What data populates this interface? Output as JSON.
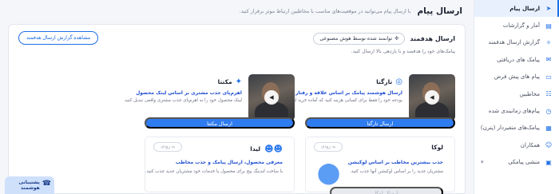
{
  "sidebar": {
    "items": [
      {
        "label": "ارسال پیام",
        "icon": "send-icon",
        "glyph": "➤",
        "active": true,
        "chev": false
      },
      {
        "label": "آمار و گزارشات",
        "icon": "chart-icon",
        "glyph": "▤",
        "active": false,
        "chev": false
      },
      {
        "label": "گزارش ارسال هدفمند",
        "icon": "sparkle-icon",
        "glyph": "✧",
        "active": false,
        "chev": false
      },
      {
        "label": "پیامک های دریافتی",
        "icon": "inbox-icon",
        "glyph": "✉",
        "active": false,
        "chev": false
      },
      {
        "label": "پیام های پیش فرض",
        "icon": "message-icon",
        "glyph": "▭",
        "active": false,
        "chev": false
      },
      {
        "label": "مخاطبین",
        "icon": "contacts-icon",
        "glyph": "☷",
        "active": false,
        "chev": false
      },
      {
        "label": "پیام‌های زمانبندی شده",
        "icon": "clock-icon",
        "glyph": "◷",
        "active": false,
        "chev": false
      },
      {
        "label": "پیامک‌های متغیردار (پترن)",
        "icon": "pattern-icon",
        "glyph": "▦",
        "active": false,
        "chev": false
      },
      {
        "label": "همکاران",
        "icon": "users-icon",
        "glyph": "☺",
        "active": false,
        "chev": false
      },
      {
        "label": "منشی پیامکی",
        "icon": "secretary-icon",
        "glyph": "▣",
        "active": false,
        "chev": true
      }
    ]
  },
  "header": {
    "title": "ارسال پیام",
    "subtitle": "با ارسال پیام می‌توانید در موقعیت‌های مناسب با مخاطبین ارتباط موثر برقرار کنید."
  },
  "panel": {
    "title": "ارسال هدفمند",
    "ai_chip": "توانمند شده توسط هوش مصنوعی",
    "report_button": "مشاهده گزارش ارسال هدفمند",
    "description": "پیامک‌های خود را هدفمند و با بازدهی بالا ارسال کنید."
  },
  "cards": [
    {
      "title": "تارگتا",
      "subtitle": "ارسال هوشمند پیامک بر اساس علاقه و رفتار مخاطبین",
      "text": "بودجه خود را فقط برای کسانی هزینه کنید که آماده خرید از شما هستند.",
      "button": "ارسال تارگتا"
    },
    {
      "title": "مکتتا",
      "subtitle": "اهرم‌پای جذب مشتری بر اساس لینک محصول",
      "text": "لینک محصول خود را به اهرم‌پای جذب مشتری واقعی تبدیل کنید.",
      "button": "ارسال مکتتا"
    }
  ],
  "soon_cards": [
    {
      "title": "لوکا",
      "soon": "به زودی",
      "subtitle": "جذب بیشترین مخاطب بر اساس لوکیشن",
      "text": "مشتریان جدید را بر اساس لوکیشن آنها جذب کنید.",
      "button": "ارسال لوکا"
    },
    {
      "title": "لیدا",
      "soon": "به زودی",
      "subtitle": "معرفی محصول، ارسال پیامک و جذب مخاطب",
      "text": "با ساخت لندینگ پیج برای محصول یا خدمات خود مشتریان جدید جذب کنید.",
      "button": ""
    }
  ],
  "support": {
    "label": "پشتیبانی هوشمند"
  }
}
